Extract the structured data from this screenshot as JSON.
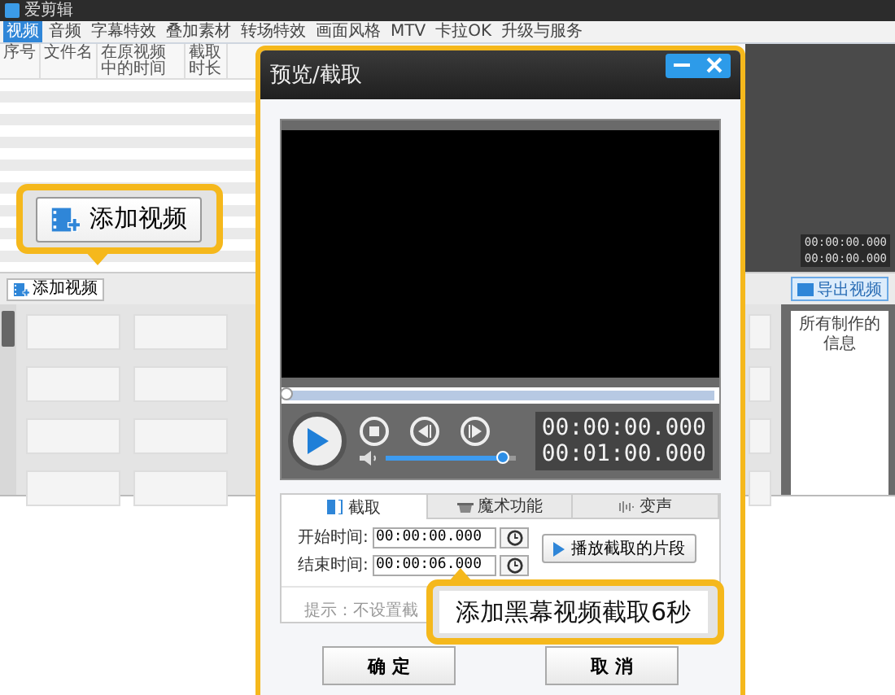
{
  "app": {
    "title": "爱剪辑"
  },
  "menu_tabs": [
    {
      "label": "视频",
      "selected": true
    },
    {
      "label": "音频",
      "selected": false
    },
    {
      "label": "字幕特效",
      "selected": false
    },
    {
      "label": "叠加素材",
      "selected": false
    },
    {
      "label": "转场特效",
      "selected": false
    },
    {
      "label": "画面风格",
      "selected": false
    },
    {
      "label": "MTV",
      "selected": false
    },
    {
      "label": "卡拉OK",
      "selected": false
    },
    {
      "label": "升级与服务",
      "selected": false
    }
  ],
  "columns": [
    "序号",
    "文件名",
    "在原视频中的时间",
    "截取时长"
  ],
  "toolbar_button": "添加视频",
  "timeline_times": [
    "00:00:00.000",
    "00:00:00.000"
  ],
  "export_button": "导出视频",
  "info_panel": {
    "title": "所有制作的信息"
  },
  "dialog": {
    "title": "预览/截取",
    "player": {
      "progress": {
        "level": 0
      },
      "volume": {
        "level": 0.9
      },
      "times": [
        "00:00:00.000",
        "00:01:00.000"
      ]
    },
    "tabs": [
      {
        "label": "截取",
        "selected": true
      },
      {
        "label": "魔术功能",
        "selected": false
      },
      {
        "label": "变声",
        "selected": false
      }
    ],
    "start_label": "开始时间:",
    "start_value": "00:00:00.000",
    "end_label": "结束时间:",
    "end_value": "00:00:06.000",
    "play_clip_button": "播放截取的片段",
    "hint": "提示：不设置截",
    "ok_button": "确 定",
    "cancel_button": "取 消"
  },
  "callouts": [
    {
      "text": "添加视频"
    },
    {
      "text": "添加黑幕视频截取6秒"
    }
  ]
}
